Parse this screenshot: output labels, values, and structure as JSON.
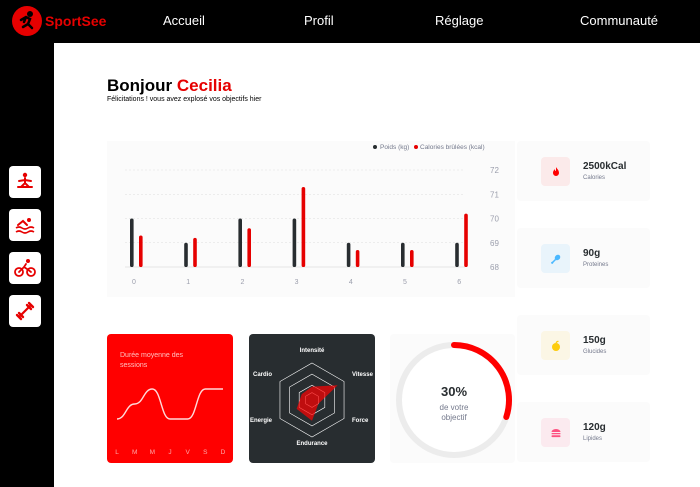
{
  "brand": {
    "name": "SportSee"
  },
  "nav": [
    {
      "label": "Accueil"
    },
    {
      "label": "Profil"
    },
    {
      "label": "Réglage"
    },
    {
      "label": "Communauté"
    }
  ],
  "sidebar": [
    {
      "icon": "yoga-icon"
    },
    {
      "icon": "swimming-icon"
    },
    {
      "icon": "cycling-icon"
    },
    {
      "icon": "dumbbell-icon"
    }
  ],
  "greeting": {
    "hello": "Bonjour",
    "name": "Cecilia",
    "message": "Félicitations ! vous avez explosé vos objectifs hier"
  },
  "colors": {
    "accent": "#e60000",
    "dark": "#282d30",
    "grey": "#74798c"
  },
  "chart_data": [
    {
      "type": "bar",
      "categories": [
        "0",
        "1",
        "2",
        "3",
        "4",
        "5",
        "6"
      ],
      "series": [
        {
          "name": "Poids (kg)",
          "values": [
            70,
            69,
            70,
            70,
            69,
            69,
            69
          ]
        },
        {
          "name": "Calories brûlées (kcal)",
          "values": [
            69.3,
            69.2,
            69.6,
            71.3,
            68.7,
            68.7,
            70.2
          ]
        }
      ],
      "yticks": [
        "72",
        "71",
        "70",
        "69",
        "68"
      ],
      "ylim": [
        68,
        72
      ],
      "legend": "top-right"
    },
    {
      "type": "line",
      "title": "Durée moyenne des sessions",
      "categories": [
        "L",
        "M",
        "M",
        "J",
        "V",
        "S",
        "D"
      ],
      "values": [
        30,
        40,
        50,
        30,
        30,
        50,
        50
      ]
    },
    {
      "type": "radar",
      "axes": [
        "Intensité",
        "Vitesse",
        "Force",
        "Endurance",
        "Energie",
        "Cardio"
      ],
      "values": [
        90,
        200,
        50,
        140,
        120,
        80
      ],
      "max": 250
    },
    {
      "type": "radial",
      "value": 30,
      "label": "30%",
      "subtitle": [
        "de votre",
        "objectif"
      ]
    }
  ],
  "key_data": [
    {
      "value": "2500kCal",
      "label": "Calories",
      "icon": "fire-icon",
      "bg": "#fbeaea",
      "color": "#ff0000"
    },
    {
      "value": "90g",
      "label": "Proteines",
      "icon": "drumstick-icon",
      "bg": "#e9f4fb",
      "color": "#4ab8ff"
    },
    {
      "value": "150g",
      "label": "Glucides",
      "icon": "apple-icon",
      "bg": "#fbf6e5",
      "color": "#fdcc0c"
    },
    {
      "value": "120g",
      "label": "Lipides",
      "icon": "burger-icon",
      "bg": "#fbeaef",
      "color": "#fd5181"
    }
  ]
}
